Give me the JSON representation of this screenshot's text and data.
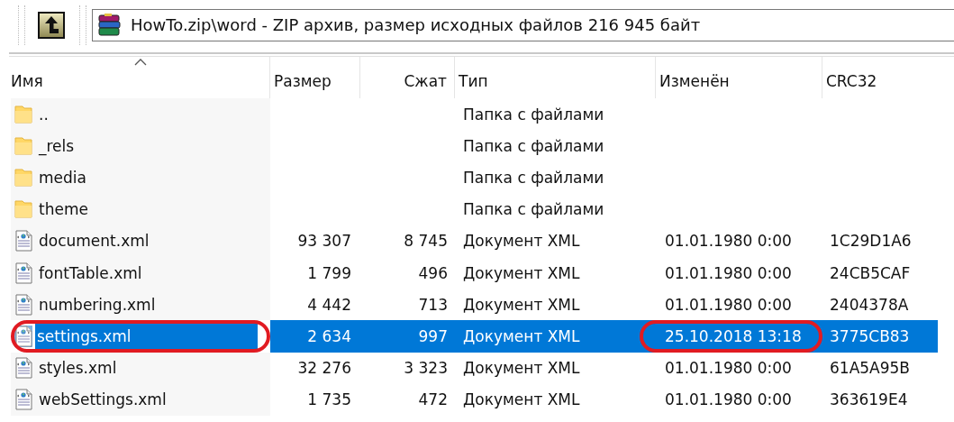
{
  "toolbar": {
    "path": "HowTo.zip\\word - ZIP архив, размер исходных файлов 216 945 байт"
  },
  "table": {
    "columns": [
      {
        "label": "Имя",
        "sorted": true
      },
      {
        "label": "Размер",
        "sorted": false
      },
      {
        "label": "Сжат",
        "sorted": false
      },
      {
        "label": "Тип",
        "sorted": false
      },
      {
        "label": "Изменён",
        "sorted": false
      },
      {
        "label": "CRC32",
        "sorted": false
      }
    ],
    "rows": [
      {
        "kind": "folder",
        "name": "..",
        "size": "",
        "packed": "",
        "type": "Папка с файлами",
        "modified": "",
        "crc": "",
        "selected": false,
        "circled_name": false,
        "circled_modified": false
      },
      {
        "kind": "folder",
        "name": "_rels",
        "size": "",
        "packed": "",
        "type": "Папка с файлами",
        "modified": "",
        "crc": "",
        "selected": false,
        "circled_name": false,
        "circled_modified": false
      },
      {
        "kind": "folder",
        "name": "media",
        "size": "",
        "packed": "",
        "type": "Папка с файлами",
        "modified": "",
        "crc": "",
        "selected": false,
        "circled_name": false,
        "circled_modified": false
      },
      {
        "kind": "folder",
        "name": "theme",
        "size": "",
        "packed": "",
        "type": "Папка с файлами",
        "modified": "",
        "crc": "",
        "selected": false,
        "circled_name": false,
        "circled_modified": false
      },
      {
        "kind": "xml",
        "name": "document.xml",
        "size": "93 307",
        "packed": "8 745",
        "type": "Документ XML",
        "modified": "01.01.1980 0:00",
        "crc": "1C29D1A6",
        "selected": false,
        "circled_name": false,
        "circled_modified": false
      },
      {
        "kind": "xml",
        "name": "fontTable.xml",
        "size": "1 799",
        "packed": "496",
        "type": "Документ XML",
        "modified": "01.01.1980 0:00",
        "crc": "24CB5CAF",
        "selected": false,
        "circled_name": false,
        "circled_modified": false
      },
      {
        "kind": "xml",
        "name": "numbering.xml",
        "size": "4 442",
        "packed": "713",
        "type": "Документ XML",
        "modified": "01.01.1980 0:00",
        "crc": "2404378A",
        "selected": false,
        "circled_name": false,
        "circled_modified": false
      },
      {
        "kind": "xml",
        "name": "settings.xml",
        "size": "2 634",
        "packed": "997",
        "type": "Документ XML",
        "modified": "25.10.2018 13:18",
        "crc": "3775CB83",
        "selected": true,
        "circled_name": true,
        "circled_modified": true
      },
      {
        "kind": "xml",
        "name": "styles.xml",
        "size": "32 276",
        "packed": "3 323",
        "type": "Документ XML",
        "modified": "01.01.1980 0:00",
        "crc": "61A5A95B",
        "selected": false,
        "circled_name": false,
        "circled_modified": false
      },
      {
        "kind": "xml",
        "name": "webSettings.xml",
        "size": "1 735",
        "packed": "472",
        "type": "Документ XML",
        "modified": "01.01.1980 0:00",
        "crc": "363619E4",
        "selected": false,
        "circled_name": false,
        "circled_modified": false
      }
    ]
  }
}
